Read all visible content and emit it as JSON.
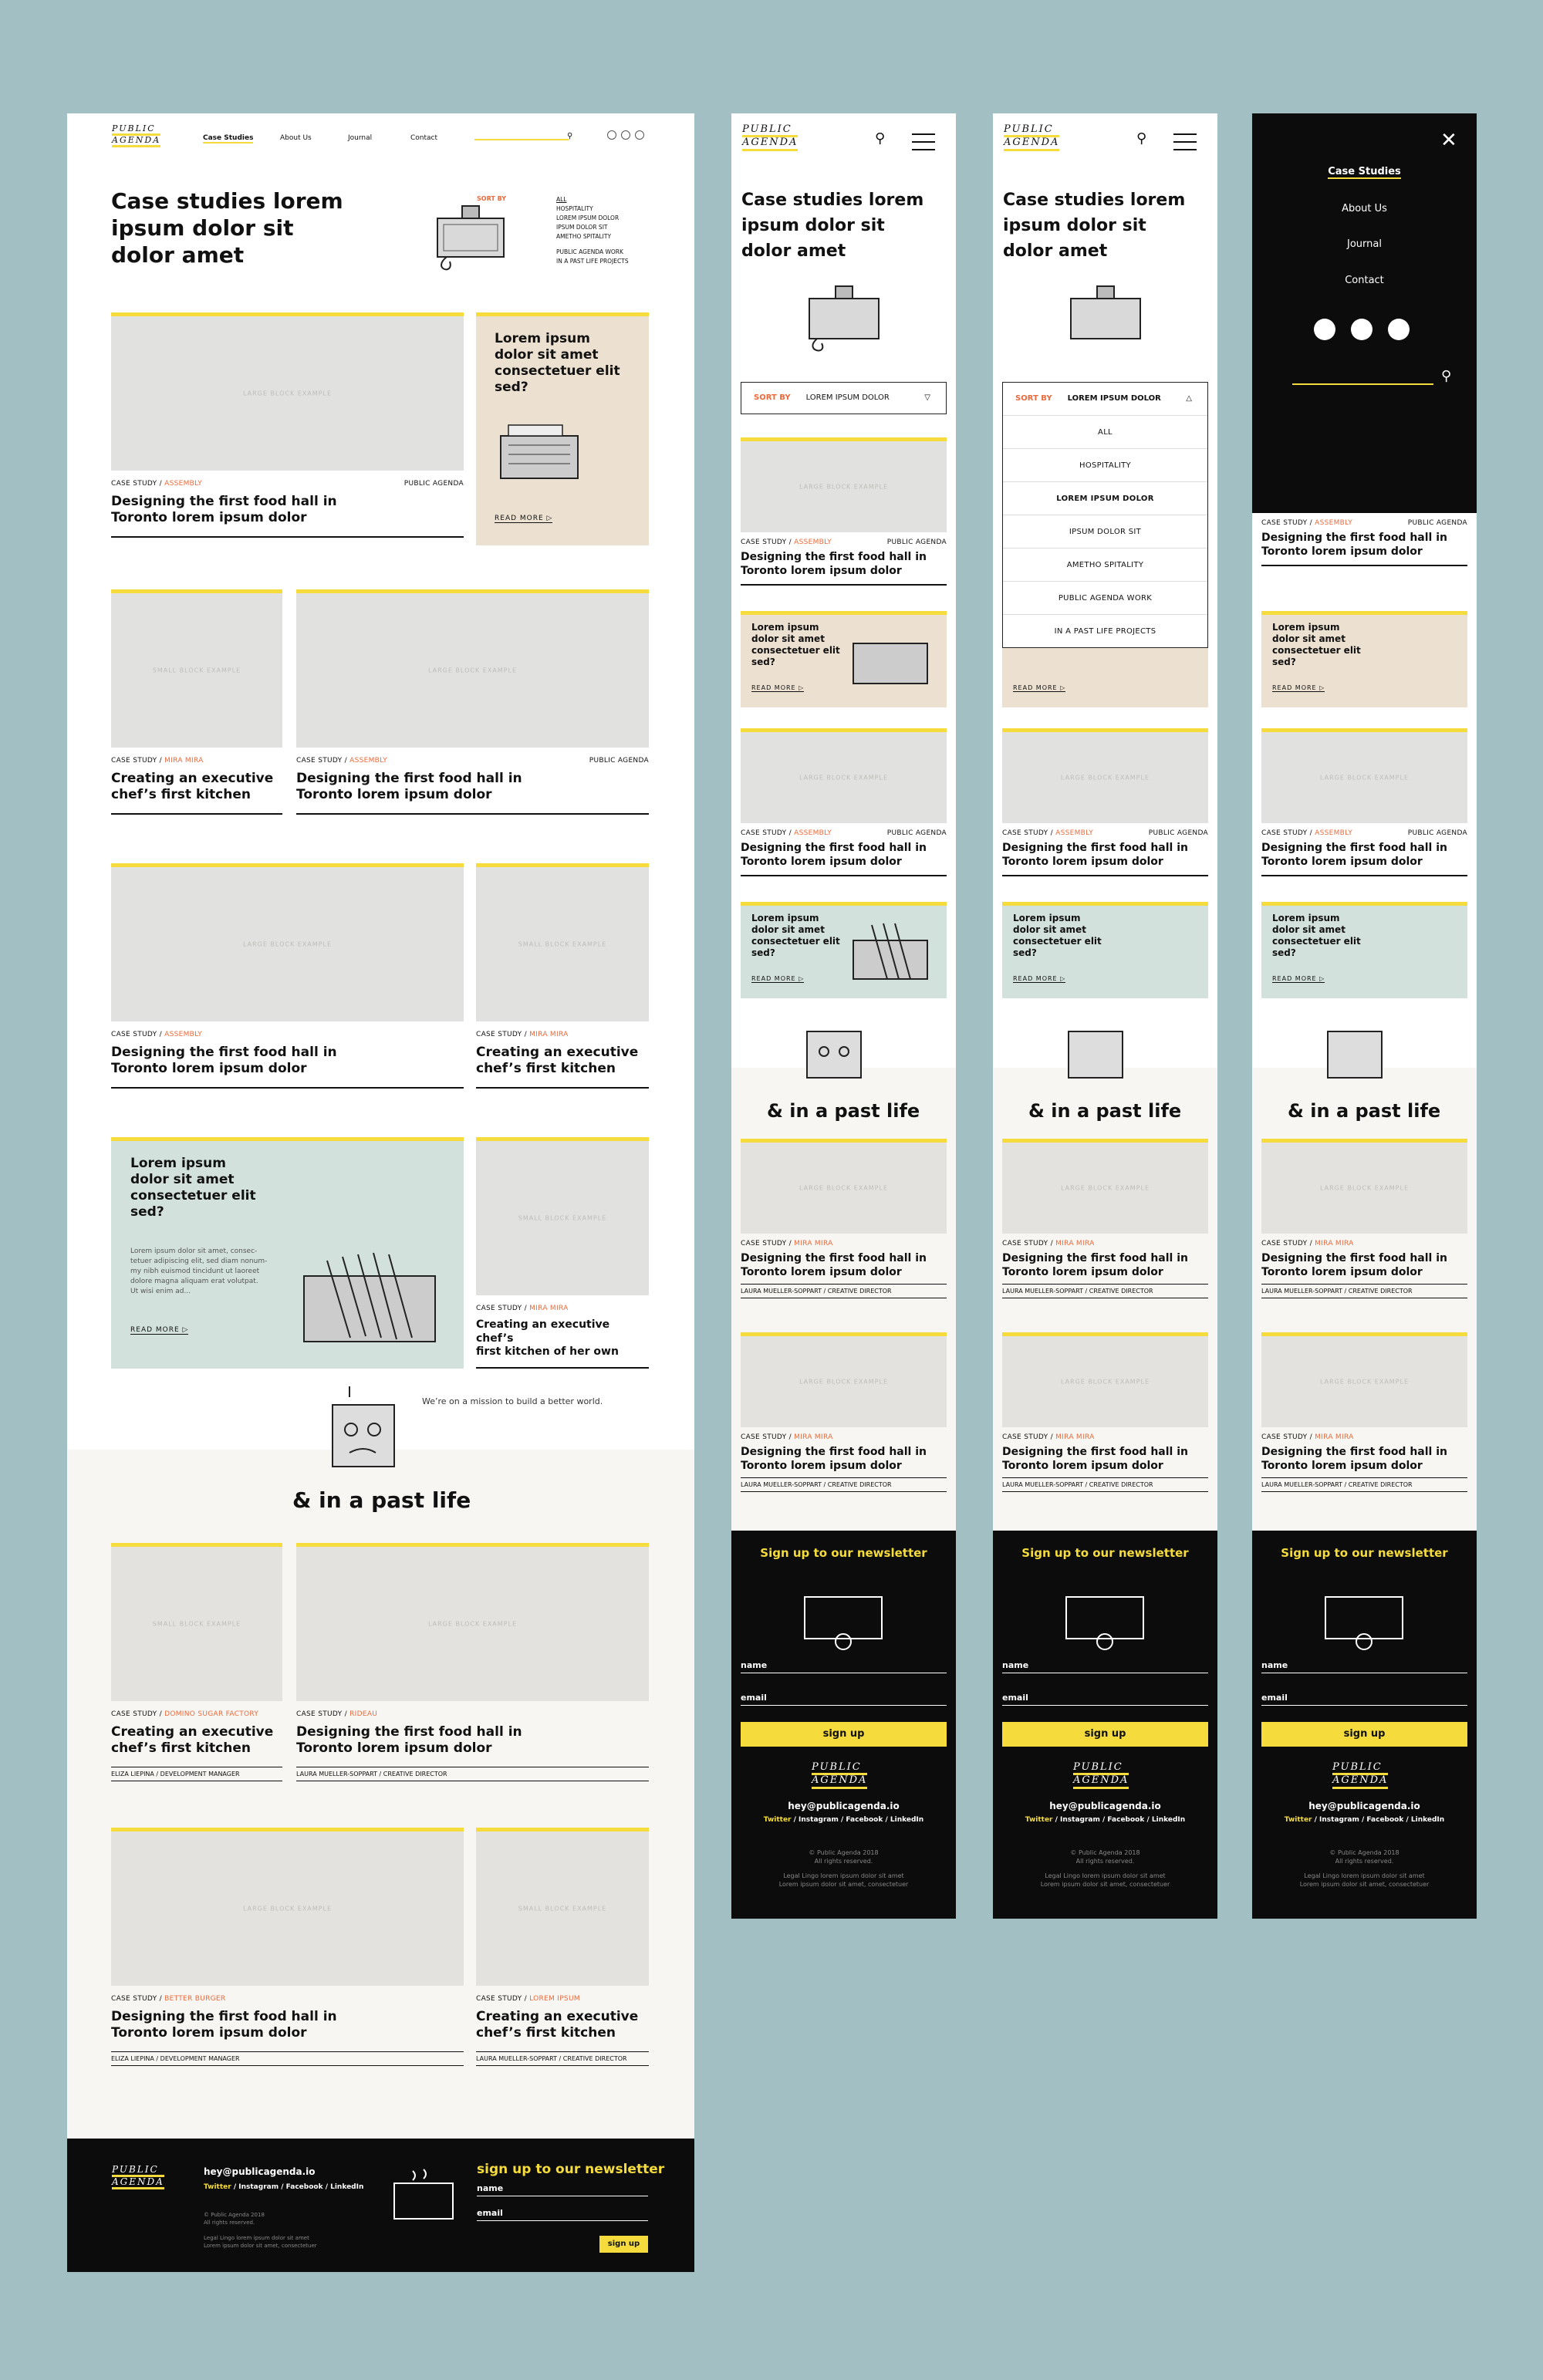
{
  "brand": {
    "logo_line1": "PUBLIC",
    "logo_line2": "AGENDA"
  },
  "nav": {
    "case_studies": "Case Studies",
    "about": "About Us",
    "journal": "Journal",
    "contact": "Contact"
  },
  "hero": {
    "title_l1": "Case studies lorem",
    "title_l2": "ipsum dolor sit",
    "title_l3": "dolor amet"
  },
  "sort": {
    "label": "SORT BY",
    "options": [
      "ALL",
      "HOSPITALITY",
      "LOREM IPSUM DOLOR",
      "IPSUM DOLOR SIT",
      "AMETHO SPITALITY",
      "PUBLIC AGENDA WORK",
      "IN A PAST LIFE PROJECTS"
    ],
    "selected": "LOREM IPSUM DOLOR"
  },
  "placeholders": {
    "large": "LARGE BLOCK EXAMPLE",
    "small": "SMALL BLOCK EXAMPLE"
  },
  "cards": {
    "case_study": "CASE STUDY /",
    "assembly": "ASSEMBLY",
    "mira_mira": "MIRA MIRA",
    "public_agenda": "PUBLIC AGENDA",
    "food_hall_l1": "Designing the first food hall in",
    "food_hall_l2": "Toronto lorem ipsum dolor",
    "exec_l1": "Creating an executive",
    "exec_l2": "chef’s first kitchen",
    "exec_own_l1": "Creating an executive chef’s",
    "exec_own_l2": "first kitchen of her own",
    "domino": "DOMINO SUGAR FACTORY",
    "rideau": "RIDEAU",
    "better_burger": "BETTER BURGER",
    "lorem_ipsum": "LOREM IPSUM",
    "eliza": "ELIZA LIEPINA  /  DEVELOPMENT MANAGER",
    "laura": "LAURA MUELLER-SOPPART  /  CREATIVE DIRECTOR"
  },
  "promo": {
    "q_l1": "Lorem ipsum",
    "q_l2": "dolor sit amet",
    "q_l3": "consectetuer elit",
    "q_l4": "sed?",
    "body_l1": "Lorem ipsum dolor sit amet, consec-",
    "body_l2": "tetuer adipiscing elit, sed diam nonum-",
    "body_l3": "my nibh euismod tincidunt ut laoreet",
    "body_l4": "dolore magna aliquam erat volutpat.",
    "body_l5": "Ut wisi enim ad...",
    "read_more": "READ MORE"
  },
  "past": {
    "mission": "We’re on a mission to build a better world.",
    "heading": "& in a past life"
  },
  "newsletter": {
    "heading": "sign up to our newsletter",
    "heading_mobile": "Sign up to our newsletter",
    "name": "name",
    "email": "email",
    "button": "sign up"
  },
  "footer": {
    "email": "hey@publicagenda.io",
    "twitter": "Twitter",
    "socials_rest": " / Instagram / Facebook / LinkedIn",
    "copyright_l1": "© Public Agenda 2018",
    "copyright_l2": "All rights reserved.",
    "legal_l1": "Legal Lingo lorem ipsum dolor sit amet",
    "legal_l2": "Lorem ipsum dolor sit amet, consectetuer"
  },
  "colors": {
    "bg": "#a2c0c3",
    "yellow": "#f5dc3c",
    "orange": "#ec6a3c",
    "beige": "#ece0d0",
    "mint": "#d2e1dc",
    "dark": "#0c0c0c"
  }
}
